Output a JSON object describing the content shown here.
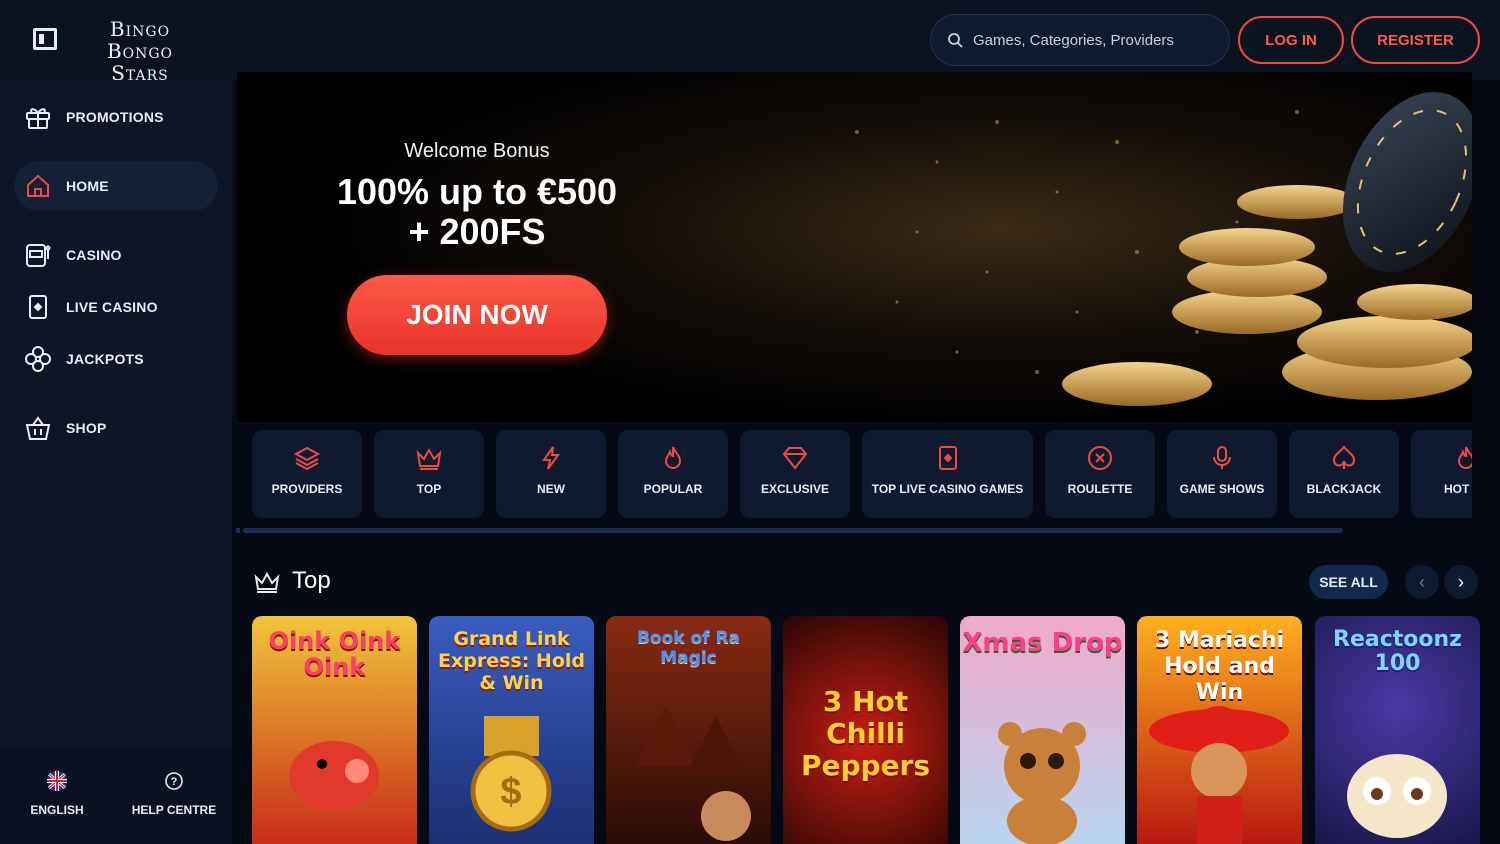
{
  "header": {
    "logo": [
      "Bingo Bongo",
      "Stars"
    ],
    "search_placeholder": "Games, Categories, Providers",
    "login_label": "LOG IN",
    "register_label": "REGISTER"
  },
  "sidebar": {
    "items": [
      {
        "label": "PROMOTIONS",
        "icon": "gift-icon"
      },
      {
        "label": "HOME",
        "icon": "home-icon"
      },
      {
        "label": "CASINO",
        "icon": "slot-machine-icon"
      },
      {
        "label": "LIVE CASINO",
        "icon": "card-icon"
      },
      {
        "label": "JACKPOTS",
        "icon": "clover-icon"
      },
      {
        "label": "SHOP",
        "icon": "basket-icon"
      }
    ],
    "footer": {
      "language": "ENGLISH",
      "help": "HELP CENTRE"
    }
  },
  "hero": {
    "subtitle": "Welcome Bonus",
    "title_line1": "100% up to €500",
    "title_line2": "+ 200FS",
    "cta": "JOIN NOW"
  },
  "categories": [
    {
      "label": "PROVIDERS",
      "icon": "layers-icon"
    },
    {
      "label": "TOP",
      "icon": "crown-icon"
    },
    {
      "label": "NEW",
      "icon": "bolt-icon"
    },
    {
      "label": "POPULAR",
      "icon": "flame-icon"
    },
    {
      "label": "EXCLUSIVE",
      "icon": "diamond-icon"
    },
    {
      "label": "TOP LIVE CASINO GAMES",
      "icon": "card-icon"
    },
    {
      "label": "ROULETTE",
      "icon": "roulette-icon"
    },
    {
      "label": "GAME SHOWS",
      "icon": "microphone-icon"
    },
    {
      "label": "BLACKJACK",
      "icon": "spade-icon"
    },
    {
      "label": "HOT JA",
      "icon": "flame-icon"
    }
  ],
  "section": {
    "title": "Top",
    "see_all": "SEE ALL"
  },
  "games": [
    {
      "title": "Oink Oink Oink",
      "colors": [
        "#ffcf33",
        "#d22a1a"
      ]
    },
    {
      "title": "Grand Link Express: Hold & Win",
      "colors": [
        "#3a5cc0",
        "#1b2f73"
      ]
    },
    {
      "title": "Book of Ra Magic",
      "colors": [
        "#8a2a12",
        "#2a0c06"
      ]
    },
    {
      "title": "3 Hot Chilli Peppers",
      "colors": [
        "#b81a12",
        "#3a0806"
      ]
    },
    {
      "title": "Xmas Drop",
      "colors": [
        "#f0a9c9",
        "#b9d4ef"
      ]
    },
    {
      "title": "3 Mariachi Hold and Win",
      "colors": [
        "#ffb020",
        "#b8180f"
      ]
    },
    {
      "title": "Reactoonz 100",
      "colors": [
        "#4a3aa8",
        "#1a154a"
      ]
    }
  ],
  "accent": "#f04a3e"
}
